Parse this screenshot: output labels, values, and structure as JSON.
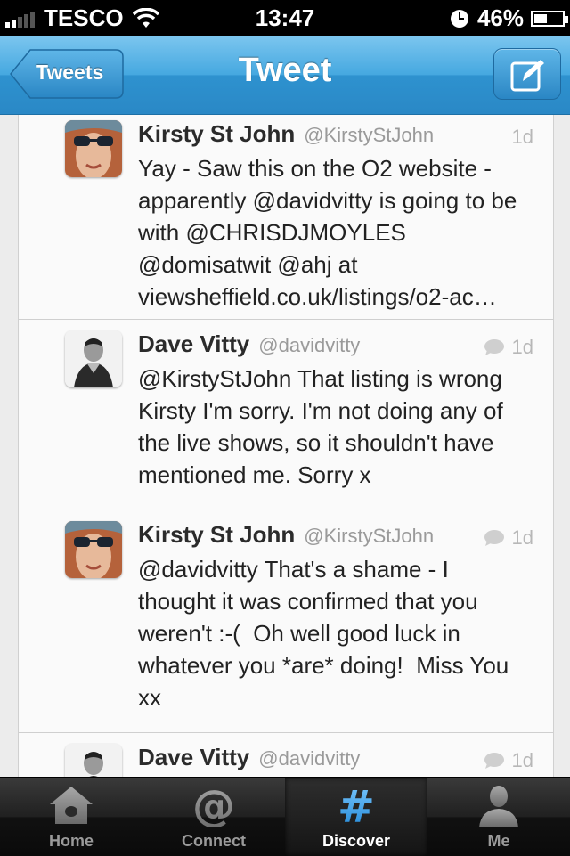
{
  "status_bar": {
    "carrier": "TESCO",
    "time": "13:47",
    "battery": "46%"
  },
  "nav": {
    "back_label": "Tweets",
    "title": "Tweet",
    "compose_icon": "compose-icon"
  },
  "tweets": [
    {
      "name": "Kirsty St John",
      "handle": "@KirstyStJohn",
      "time": "1d",
      "has_reply_icon": false,
      "text": "Yay - Saw this on the O2 website - apparently @davidvitty is going to be with @CHRISDJMOYLES @domisatwit @ahj at viewsheffield.co.uk/listings/o2-ac…"
    },
    {
      "name": "Dave Vitty",
      "handle": "@davidvitty",
      "time": "1d",
      "has_reply_icon": true,
      "text": "@KirstyStJohn That listing is wrong Kirsty I'm sorry. I'm not doing any of the live shows, so it shouldn't have mentioned me. Sorry x"
    },
    {
      "name": "Kirsty St John",
      "handle": "@KirstyStJohn",
      "time": "1d",
      "has_reply_icon": true,
      "text": "@davidvitty That's a shame - I thought it was confirmed that you weren't :-(  Oh well good luck in whatever you *are* doing!  Miss You xx"
    },
    {
      "name": "Dave Vitty",
      "handle": "@davidvitty",
      "time": "1d",
      "has_reply_icon": true,
      "text": ""
    }
  ],
  "tabs": [
    {
      "label": "Home",
      "icon": "home-icon",
      "selected": false
    },
    {
      "label": "Connect",
      "icon": "at-icon",
      "selected": false
    },
    {
      "label": "Discover",
      "icon": "hash-icon",
      "selected": true
    },
    {
      "label": "Me",
      "icon": "person-icon",
      "selected": false
    }
  ],
  "colors": {
    "nav_blue": "#2a88c6",
    "discover_blue": "#3fa9f5"
  }
}
